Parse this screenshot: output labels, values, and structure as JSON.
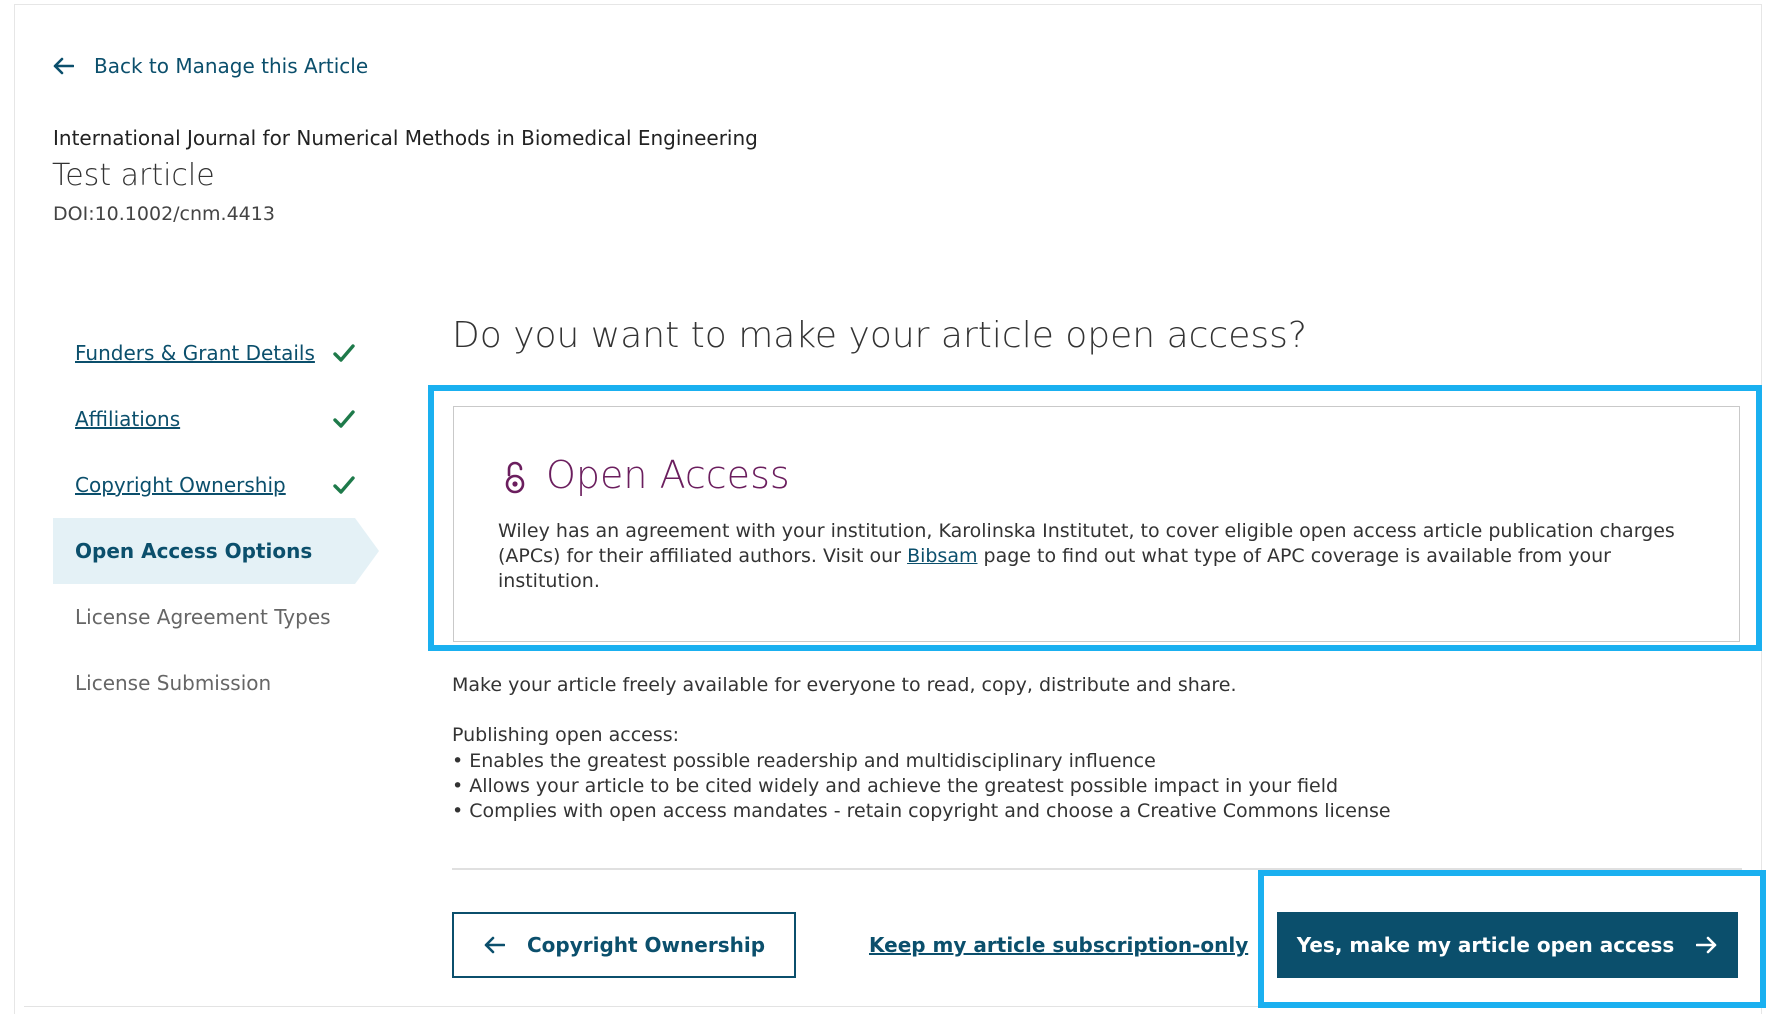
{
  "back_link": {
    "label": "Back to Manage this Article",
    "icon": "arrow-left-icon"
  },
  "article": {
    "journal": "International Journal for Numerical Methods in Biomedical Engineering",
    "title": "Test article",
    "doi": "DOI:10.1002/cnm.4413"
  },
  "steps": [
    {
      "label": "Funders & Grant Details",
      "status": "complete"
    },
    {
      "label": "Affiliations",
      "status": "complete"
    },
    {
      "label": "Copyright Ownership",
      "status": "complete"
    },
    {
      "label": "Open Access Options",
      "status": "active"
    },
    {
      "label": "License Agreement Types",
      "status": "pending"
    },
    {
      "label": "License Submission",
      "status": "pending"
    }
  ],
  "main": {
    "question": "Do you want to make your article open access?",
    "oa_card": {
      "icon": "open-lock-icon",
      "title": "Open Access",
      "text_before": "Wiley has an agreement with your institution, Karolinska Institutet, to cover eligible open access article publication charges (APCs) for their affiliated authors. Visit our ",
      "link": "Bibsam",
      "text_after": " page to find out what type of APC coverage is available from your institution."
    },
    "intro": "Make your article freely available for everyone to read, copy, distribute and share.",
    "publishing_label": "Publishing open access:",
    "bullets": [
      "Enables the greatest possible readership and multidisciplinary influence",
      "Allows your article to be cited widely and achieve the greatest possible impact in your field",
      "Complies with open access mandates - retain copyright and choose a Creative Commons license"
    ]
  },
  "actions": {
    "back_button": "Copyright Ownership",
    "keep_subscription": "Keep my article subscription-only",
    "yes_button": "Yes, make my article open access"
  },
  "colors": {
    "primary": "#0b4f6c",
    "open_access_title": "#6b1e5e",
    "highlight": "#1ab0f0",
    "check": "#1e7a4a",
    "active_step_bg": "#e4f1f6"
  }
}
